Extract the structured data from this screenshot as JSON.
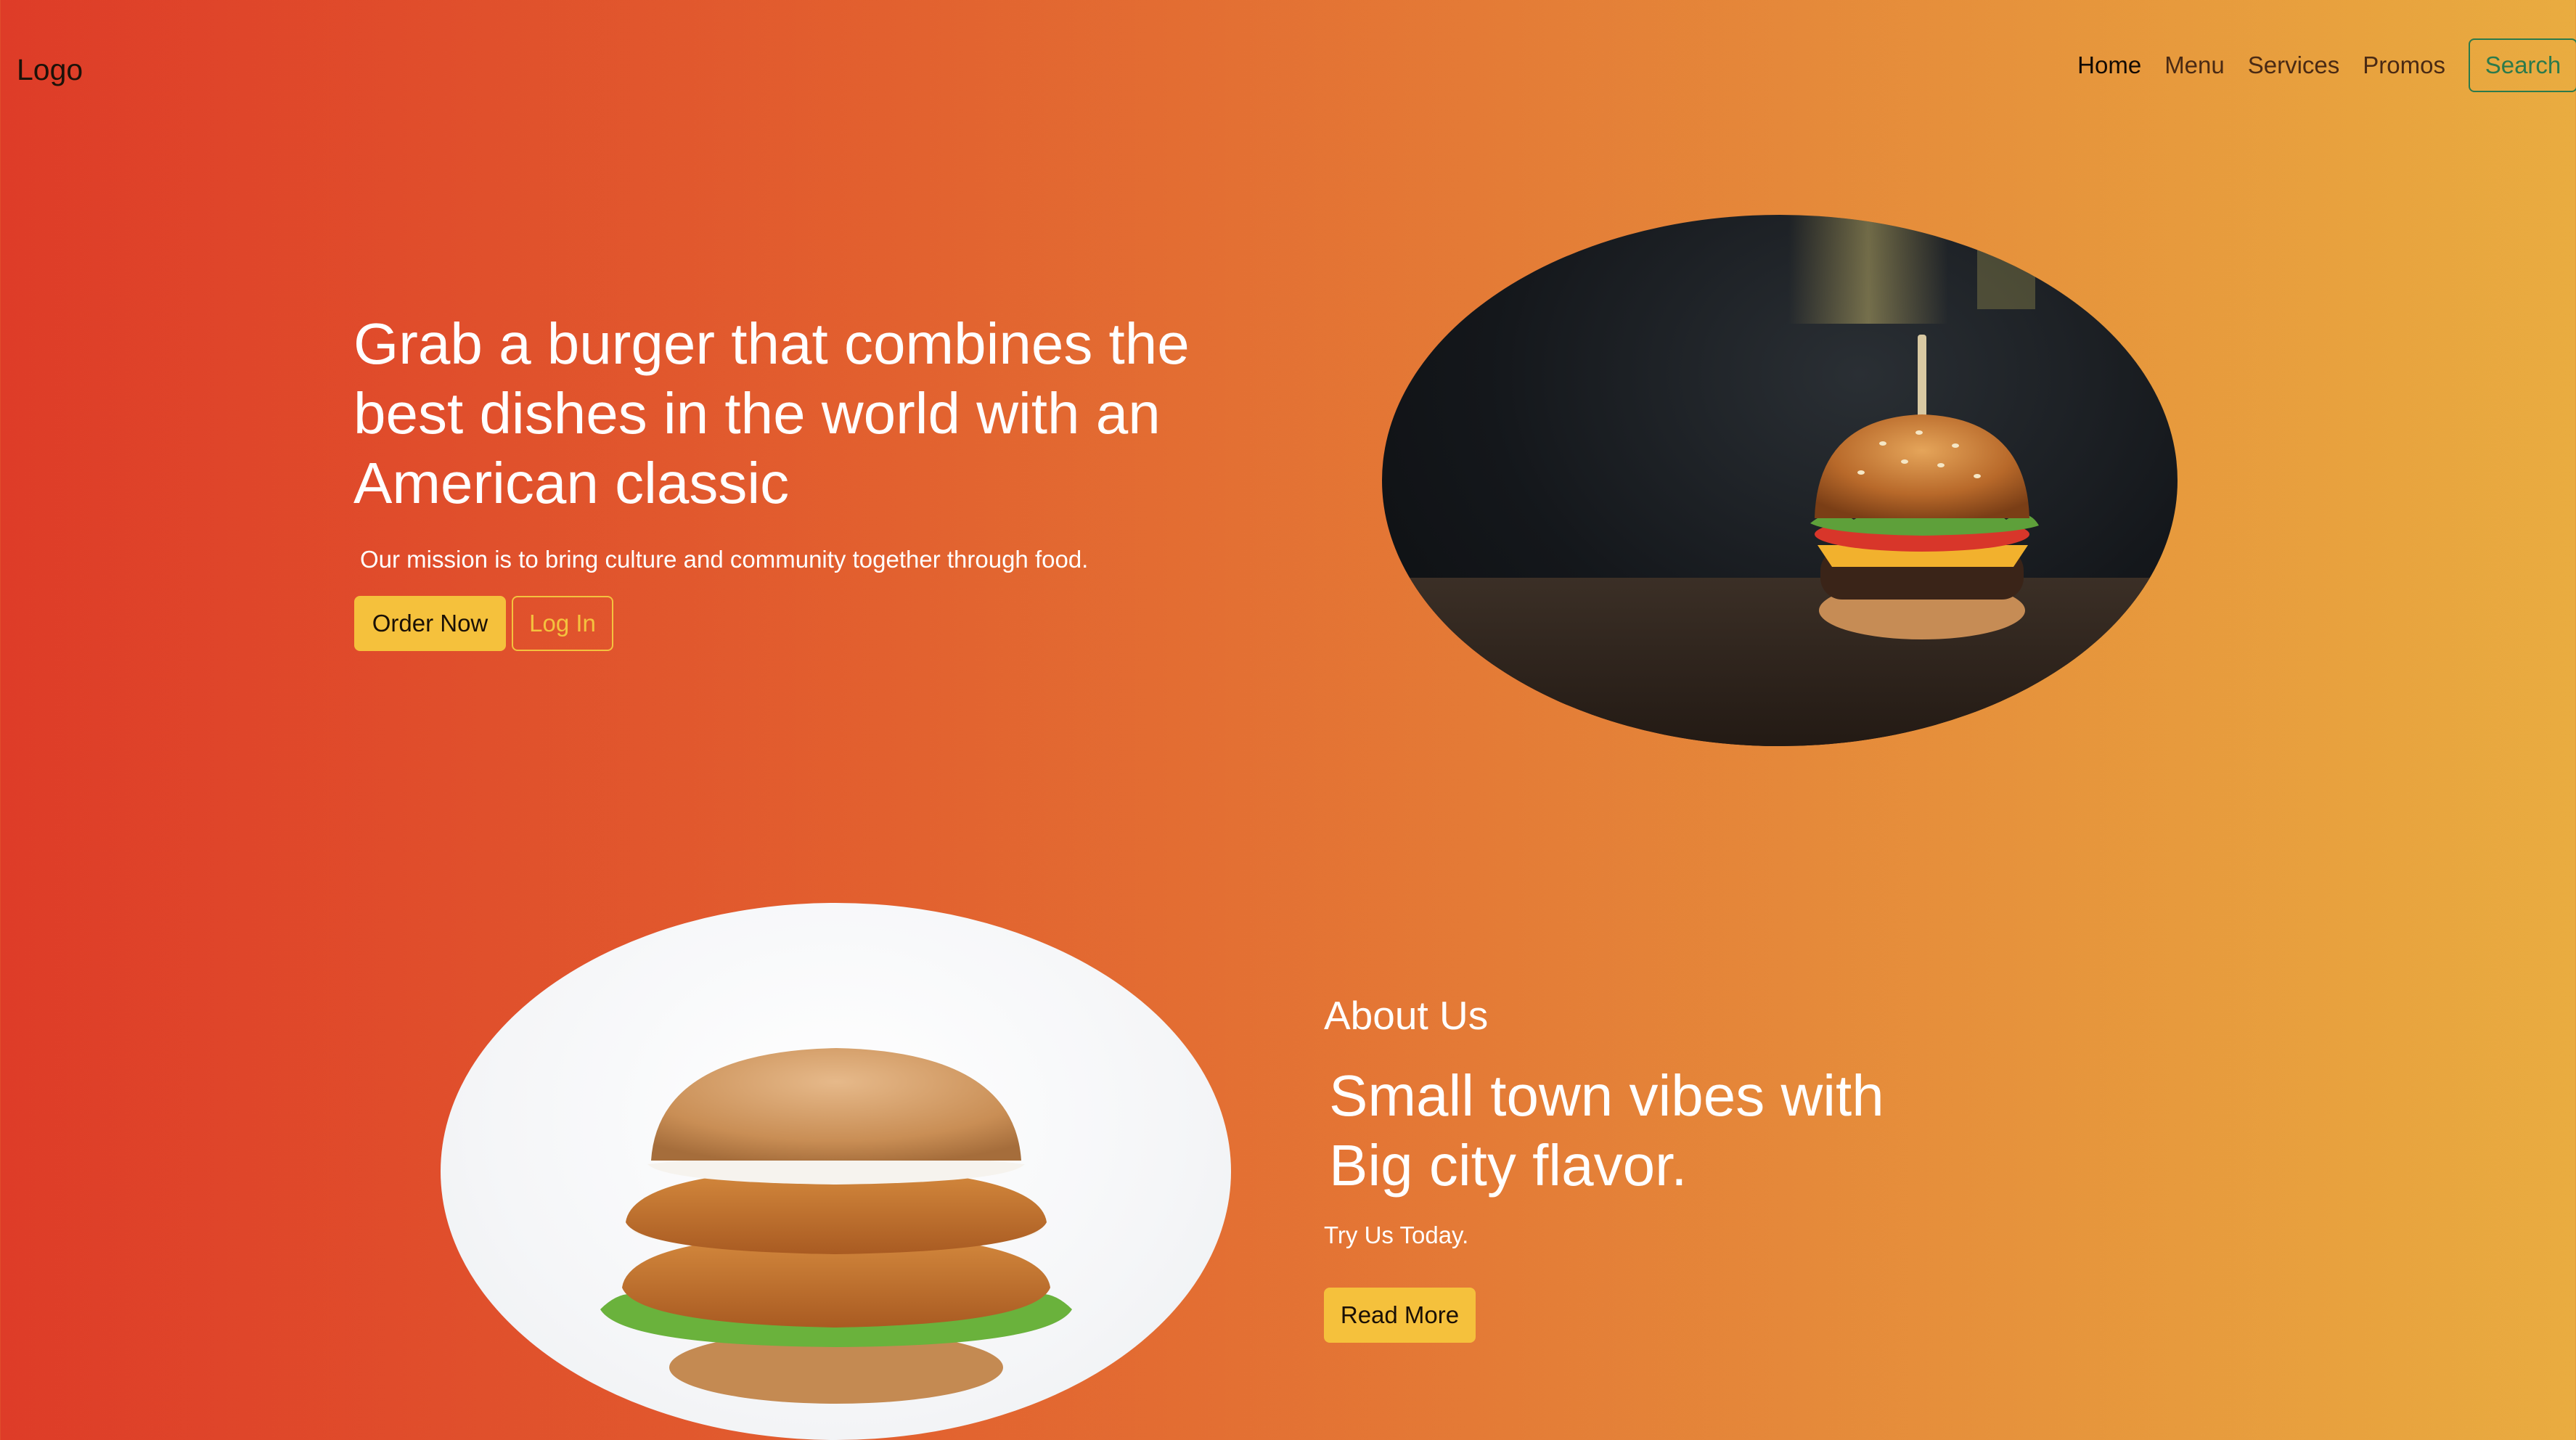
{
  "navbar": {
    "logo": "Logo",
    "links": [
      {
        "label": "Home",
        "active": true
      },
      {
        "label": "Menu",
        "active": false
      },
      {
        "label": "Services",
        "active": false
      },
      {
        "label": "Promos",
        "active": false
      }
    ],
    "search_label": "Search"
  },
  "hero": {
    "title": "Grab a burger that combines the best dishes in the world with an American classic",
    "subtitle": "Our mission is to bring culture and community together through food.",
    "order_label": "Order Now",
    "login_label": "Log In",
    "image_icon": "burger-photo"
  },
  "about": {
    "heading": "About Us",
    "title": "Small town vibes with Big city flavor.",
    "subtitle": "Try Us Today.",
    "read_more_label": "Read More",
    "image_icon": "chicken-burger-photo"
  },
  "colors": {
    "gradient_start": "#de3c28",
    "gradient_end": "#e9ac40",
    "accent_yellow": "#f5c13c",
    "search_green": "#2c7a4b",
    "text_white": "#ffffff"
  }
}
